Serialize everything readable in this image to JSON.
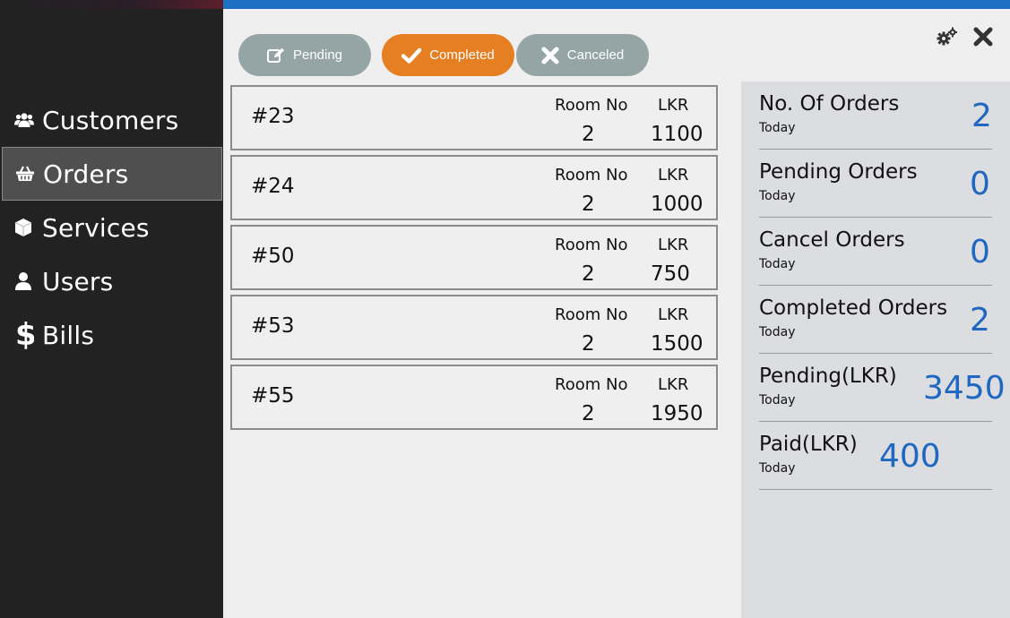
{
  "sidebar": {
    "items": [
      {
        "label": "Customers",
        "icon": "users-icon"
      },
      {
        "label": "Orders",
        "icon": "basket-icon",
        "active": true
      },
      {
        "label": "Services",
        "icon": "cube-icon"
      },
      {
        "label": "Users",
        "icon": "user-icon"
      },
      {
        "label": "Bills",
        "icon": "dollar-icon"
      }
    ]
  },
  "tabs": {
    "pending": "Pending",
    "completed": "Completed",
    "canceled": "Canceled"
  },
  "toolbar": {
    "settings_icon": "gears-icon",
    "close_icon": "close-icon"
  },
  "orders": {
    "room_header": "Room No",
    "amount_header": "LKR",
    "items": [
      {
        "id": "#23",
        "room": "2",
        "amount": "1100"
      },
      {
        "id": "#24",
        "room": "2",
        "amount": "1000"
      },
      {
        "id": "#50",
        "room": "2",
        "amount": "750"
      },
      {
        "id": "#53",
        "room": "2",
        "amount": "1500"
      },
      {
        "id": "#55",
        "room": "2",
        "amount": "1950"
      }
    ]
  },
  "stats": [
    {
      "title": "No. Of Orders",
      "sub": "Today",
      "value": "2"
    },
    {
      "title": "Pending Orders",
      "sub": "Today",
      "value": "0"
    },
    {
      "title": "Cancel Orders",
      "sub": "Today",
      "value": "0"
    },
    {
      "title": "Completed Orders",
      "sub": "Today",
      "value": "2"
    },
    {
      "title": "Pending(LKR)",
      "sub": "Today",
      "value": "3450"
    },
    {
      "title": "Paid(LKR)",
      "sub": "Today",
      "value": "400"
    }
  ],
  "colors": {
    "sidebar_bg": "#222222",
    "active_item_bg": "#4f4f4f",
    "tab_inactive": "#95a5a6",
    "tab_active": "#e67e22",
    "stat_value": "#1f67c0",
    "top_strip": "#1e6fc4"
  }
}
